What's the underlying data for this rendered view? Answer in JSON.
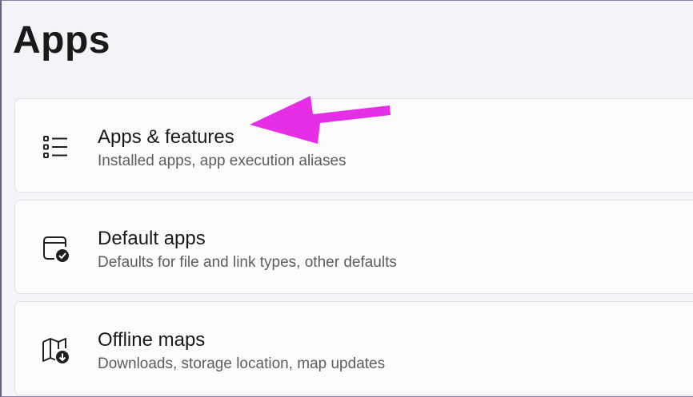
{
  "page": {
    "title": "Apps"
  },
  "items": [
    {
      "title": "Apps & features",
      "subtitle": "Installed apps, app execution aliases",
      "icon": "apps-list-icon"
    },
    {
      "title": "Default apps",
      "subtitle": "Defaults for file and link types, other defaults",
      "icon": "default-apps-check-icon"
    },
    {
      "title": "Offline maps",
      "subtitle": "Downloads, storage location, map updates",
      "icon": "offline-map-download-icon"
    }
  ],
  "annotation": {
    "arrow_color": "#e62ee6"
  }
}
